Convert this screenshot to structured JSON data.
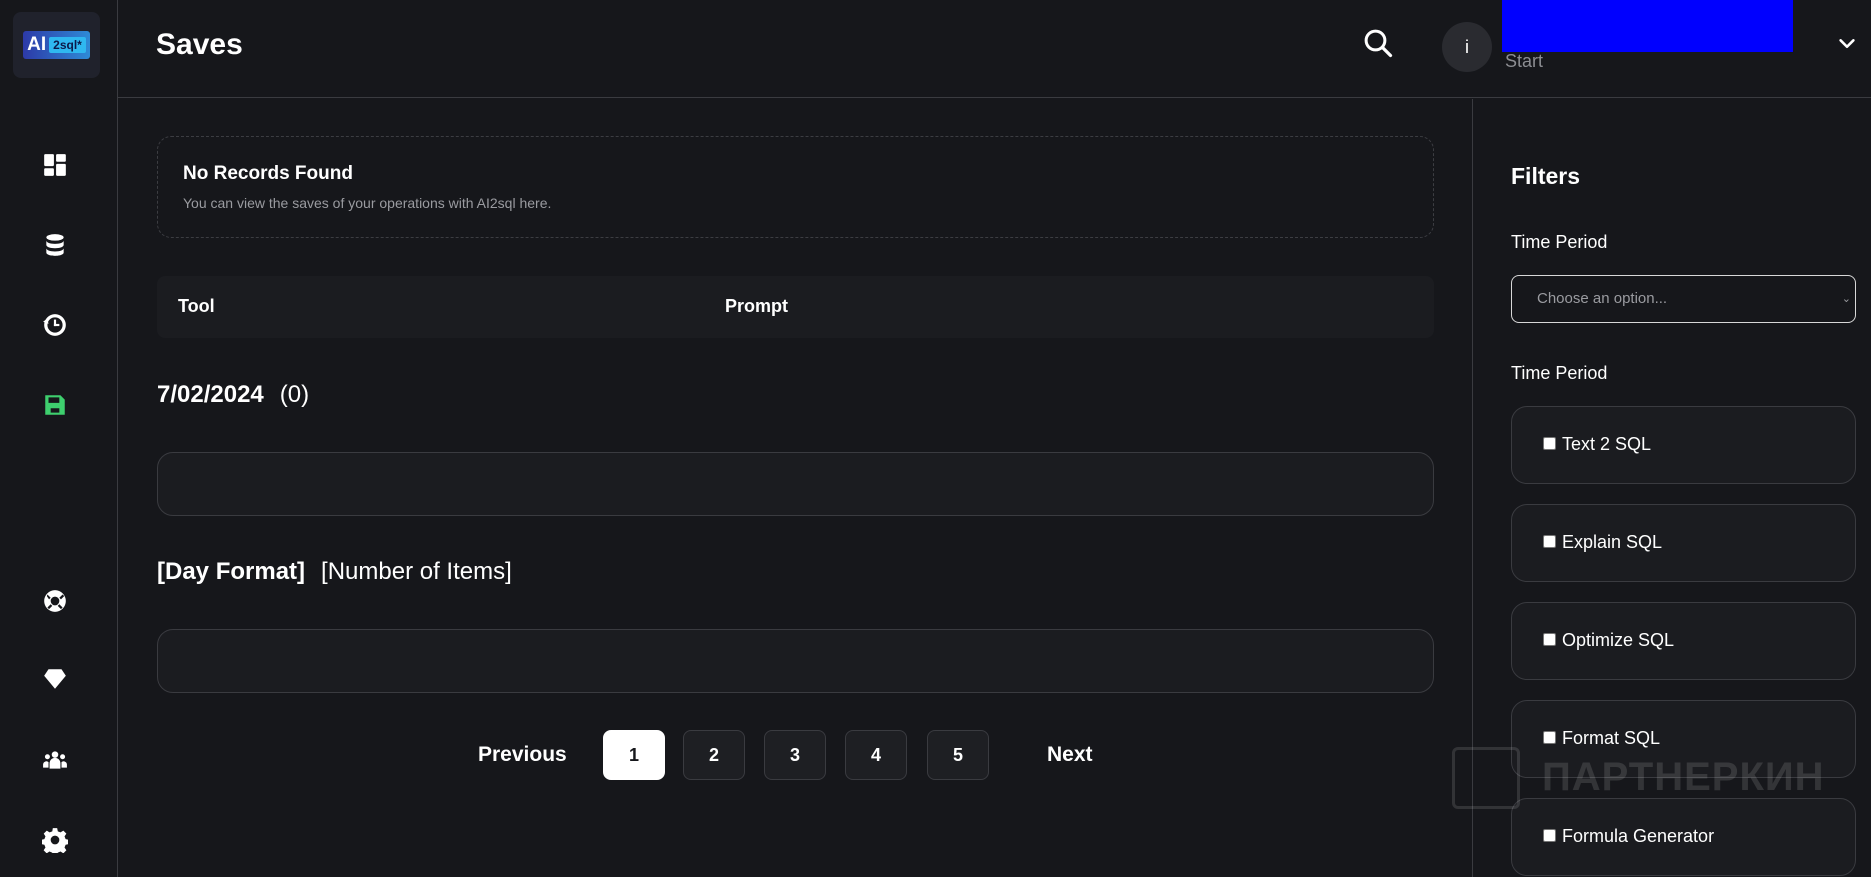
{
  "app": {
    "logo_ai": "AI",
    "logo_sql": "2sql*"
  },
  "sidebar": {
    "items": [
      {
        "icon": "dashboard-icon"
      },
      {
        "icon": "database-icon"
      },
      {
        "icon": "history-icon"
      },
      {
        "icon": "save-icon",
        "active": true
      },
      {
        "icon": "support-icon"
      },
      {
        "icon": "diamond-icon"
      },
      {
        "icon": "team-icon"
      },
      {
        "icon": "gear-icon"
      }
    ]
  },
  "header": {
    "title": "Saves",
    "avatar_initial": "i",
    "user_subtitle": "Start"
  },
  "main": {
    "empty_title": "No Records Found",
    "empty_desc": "You can view the saves of your operations with AI2sql here.",
    "columns": [
      "Tool",
      "Prompt"
    ],
    "groups": [
      {
        "day": "7/02/2024",
        "count": "(0)"
      },
      {
        "day": "[Day Format]",
        "count": "[Number of Items]"
      }
    ],
    "pager": {
      "previous": "Previous",
      "pages": [
        "1",
        "2",
        "3",
        "4",
        "5"
      ],
      "current": "1",
      "next": "Next"
    }
  },
  "filters": {
    "title": "Filters",
    "time_period_label": "Time Period",
    "select_placeholder": "Choose an option...",
    "tools_label": "Time Period",
    "options": [
      "Text 2 SQL",
      "Explain SQL",
      "Optimize SQL",
      "Format SQL",
      "Formula Generator"
    ]
  },
  "watermark": "ПАРТНЕРКИН",
  "colors": {
    "background": "#16171b",
    "accent_active": "#3ecf6e",
    "user_block": "#0000ff"
  }
}
